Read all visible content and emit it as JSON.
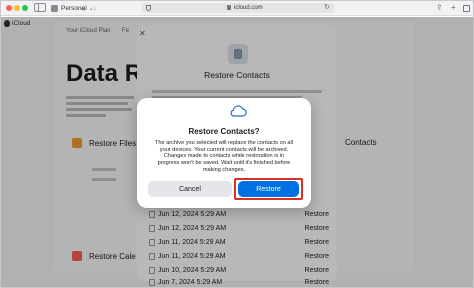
{
  "browser": {
    "profile_label": "Personal",
    "url": "icloud.com",
    "colors": {
      "close": "#ff5f57",
      "minimize": "#febc2e",
      "zoom": "#28c840"
    }
  },
  "page": {
    "brand": "iCloud",
    "nav_tabs": [
      "Your iCloud Plan",
      "Fe"
    ],
    "title": "Data Reco",
    "items": {
      "files": "Restore Files",
      "calendars": "Restore Cale",
      "right_label": "Contacts"
    }
  },
  "sheet": {
    "title": "Restore Contacts",
    "rows": [
      {
        "date": "",
        "action": ""
      },
      {
        "date": "",
        "action": ""
      },
      {
        "date": "",
        "action": ""
      },
      {
        "date": "",
        "action": ""
      },
      {
        "date": "",
        "action": ""
      },
      {
        "date": "",
        "action": ""
      },
      {
        "date": "Jun 12, 2024 5:29 AM",
        "action": "Restore"
      },
      {
        "date": "Jun 12, 2024 5:29 AM",
        "action": "Restore"
      },
      {
        "date": "Jun 11, 2024 5:29 AM",
        "action": "Restore"
      },
      {
        "date": "Jun 11, 2024 5:29 AM",
        "action": "Restore"
      },
      {
        "date": "Jun 10, 2024 5:29 AM",
        "action": "Restore"
      },
      {
        "date": "Jun 7, 2024 5:29 AM",
        "action": "Restore"
      }
    ]
  },
  "alert": {
    "title": "Restore Contacts?",
    "body": "The archive you selected will replace the contacts on all your devices. Your current contacts will be archived. Changes made to contacts while restoration is in progress won't be saved. Wait until it's finished before making changes.",
    "cancel_label": "Cancel",
    "restore_label": "Restore",
    "accent_color": "#0071e3",
    "highlight_color": "#d93025"
  }
}
